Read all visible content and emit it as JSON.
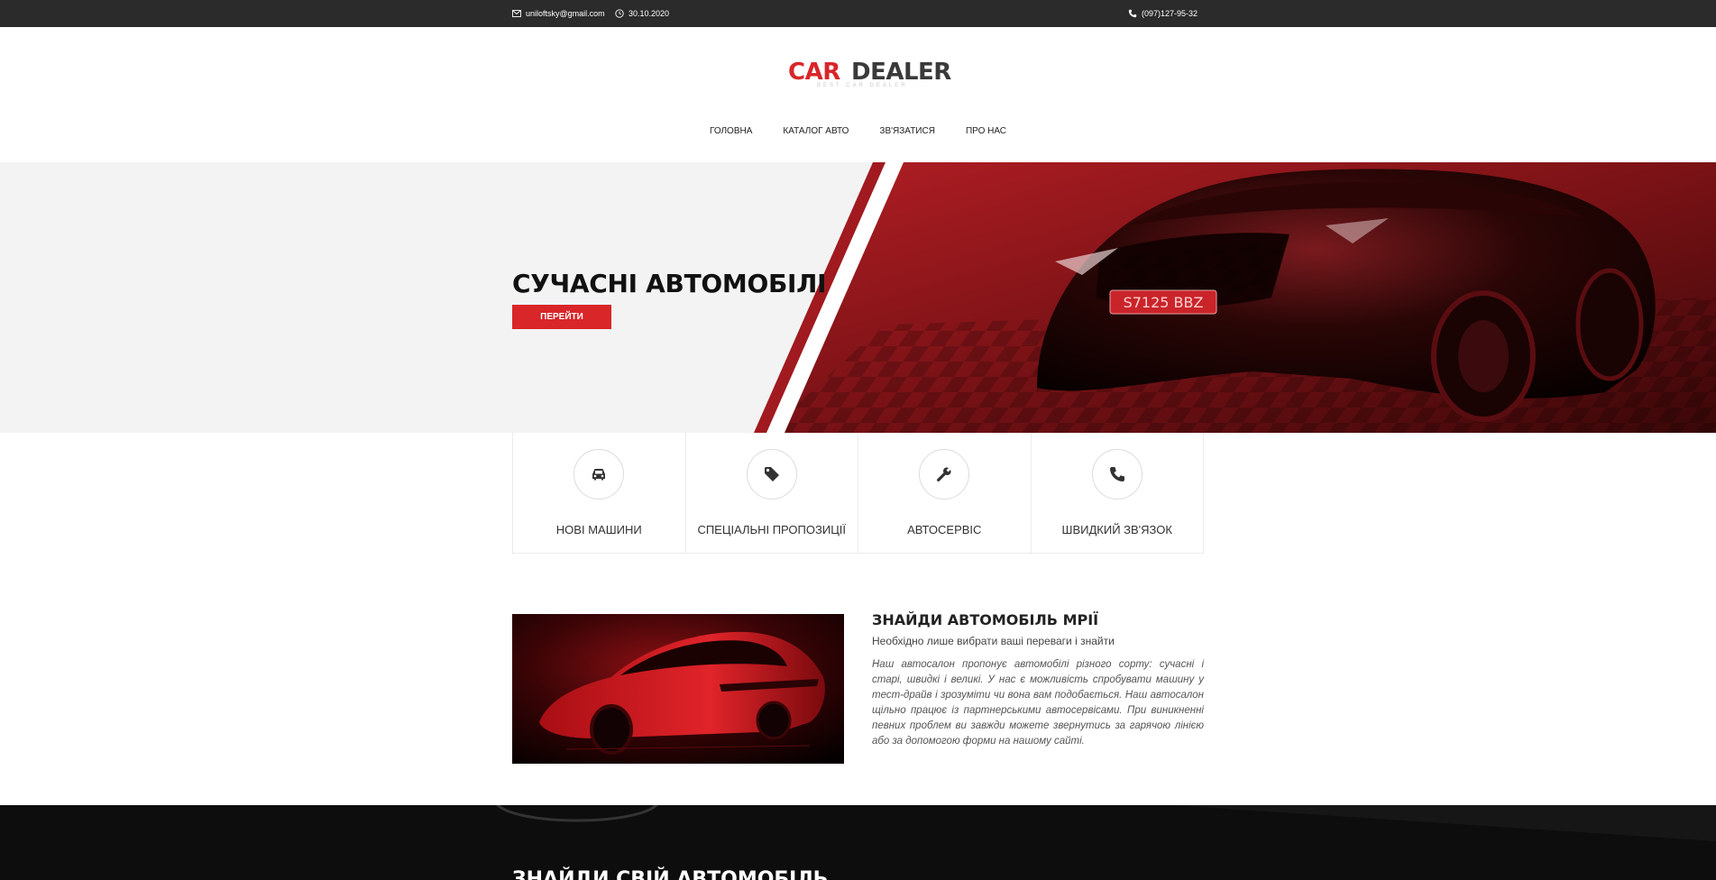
{
  "topbar": {
    "email": "uniloftsky@gmail.com",
    "date": "30.10.2020",
    "phone": "(097)127-95-32"
  },
  "logo": {
    "brand_first": "CAR",
    "brand_second": "DEALER",
    "tagline": "BEST CAR DEALER",
    "accent_color": "#d82629"
  },
  "nav": {
    "items": [
      "ГОЛОВНА",
      "КАТАЛОГ АВТО",
      "ЗВ'ЯЗАТИСЯ",
      "ПРО НАС"
    ]
  },
  "hero": {
    "title": "СУЧАСНІ АВТОМОБІЛІ",
    "button": "ПЕРЕЙТИ",
    "plate": "S7125 BBZ"
  },
  "features": [
    {
      "label": "НОВІ МАШИНИ",
      "icon": "car-icon"
    },
    {
      "label": "СПЕЦІАЛЬНІ ПРОПОЗИЦІЇ",
      "icon": "tag-icon"
    },
    {
      "label": "АВТОСЕРВІС",
      "icon": "wrench-icon"
    },
    {
      "label": "ШВИДКИЙ ЗВ'ЯЗОК",
      "icon": "phone-icon"
    }
  ],
  "about": {
    "title": "ЗНАЙДИ АВТОМОБІЛЬ МРІЇ",
    "subtitle": "Необхідно лише вибрати ваші переваги і знайти",
    "text": "Наш автосалон пропонує автомобілі різного сорту: сучасні і старі, швидкі і великі. У нас є можливість спробувати машину у тест-драйв і зрозуміти чи вона вам подобається. Наш автосалон щільно працює із партнерськими автосервісами. При виникненні певних проблем ви завжди можете звернутись за гарячою лінією або за допомогою форми на нашому сайті."
  },
  "dark_section": {
    "title": "ЗНАЙДИ СВІЙ АВТОМОБІЛЬ"
  }
}
